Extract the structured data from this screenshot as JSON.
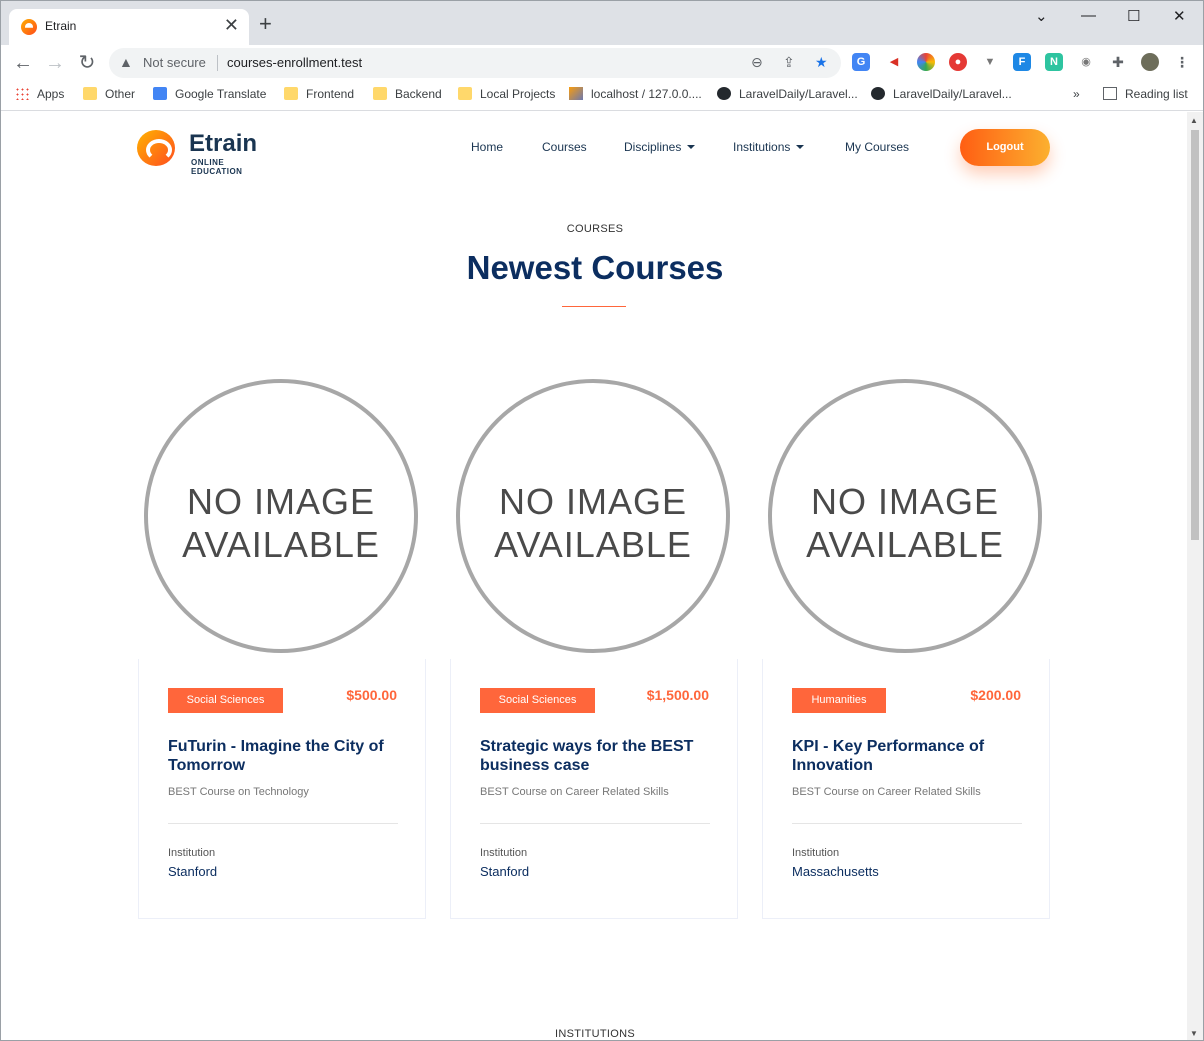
{
  "browser": {
    "tab_title": "Etrain",
    "tab_close": "✕",
    "new_tab": "+",
    "window_controls": [
      "⌄",
      "—",
      "☐",
      "✕"
    ],
    "security": "Not secure",
    "url": "courses-enrollment.test",
    "bookmarks": [
      {
        "label": "Apps",
        "icon": "apps-grid-icon"
      },
      {
        "label": "Other",
        "icon": "folder-icon"
      },
      {
        "label": "Google Translate",
        "icon": "google-translate-icon"
      },
      {
        "label": "Frontend",
        "icon": "folder-icon"
      },
      {
        "label": "Backend",
        "icon": "folder-icon"
      },
      {
        "label": "Local Projects",
        "icon": "folder-icon"
      },
      {
        "label": "localhost / 127.0.0....",
        "icon": "phpmyadmin-icon"
      },
      {
        "label": "LaravelDaily/Laravel...",
        "icon": "github-icon"
      },
      {
        "label": "LaravelDaily/Laravel...",
        "icon": "github-icon"
      }
    ],
    "more_bookmarks": "»",
    "reading_list": "Reading list"
  },
  "site": {
    "logo_name": "Etrain",
    "logo_sub": "ONLINE EDUCATION",
    "nav": [
      "Home",
      "Courses",
      "Disciplines",
      "Institutions",
      "My Courses"
    ],
    "logout": "Logout"
  },
  "section": {
    "kicker": "COURSES",
    "title": "Newest Courses",
    "next_kicker": "INSTITUTIONS"
  },
  "courses": [
    {
      "image_line1": "NO IMAGE",
      "image_line2": "AVAILABLE",
      "category": "Social Sciences",
      "price": "$500.00",
      "title": "FuTurin - Imagine the City of Tomorrow",
      "subtitle": "BEST Course on Technology",
      "institution_label": "Institution",
      "institution": "Stanford"
    },
    {
      "image_line1": "NO IMAGE",
      "image_line2": "AVAILABLE",
      "category": "Social Sciences",
      "price": "$1,500.00",
      "title": "Strategic ways for the BEST business case",
      "subtitle": "BEST Course on Career Related Skills",
      "institution_label": "Institution",
      "institution": "Stanford"
    },
    {
      "image_line1": "NO IMAGE",
      "image_line2": "AVAILABLE",
      "category": "Humanities",
      "price": "$200.00",
      "title": "KPI - Key Performance of Innovation",
      "subtitle": "BEST Course on Career Related Skills",
      "institution_label": "Institution",
      "institution": "Massachusetts"
    }
  ],
  "colors": {
    "accent": "#ff663b",
    "heading": "#0c2e60",
    "logout_start": "#ff5e13",
    "logout_end": "#fcb02f"
  }
}
